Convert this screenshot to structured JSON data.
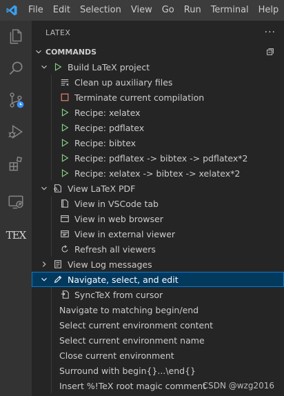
{
  "menubar": {
    "items": [
      "File",
      "Edit",
      "Selection",
      "View",
      "Go",
      "Run",
      "Terminal",
      "Help"
    ]
  },
  "activitybar": {
    "tex_label": "TEX"
  },
  "sidebar": {
    "title": "LATEX",
    "more_label": "···",
    "section": "COMMANDS",
    "groups": {
      "build": {
        "label": "Build LaTeX project",
        "children": [
          "Clean up auxiliary files",
          "Terminate current compilation",
          "Recipe: xelatex",
          "Recipe: pdflatex",
          "Recipe: bibtex",
          "Recipe: pdflatex -> bibtex -> pdflatex*2",
          "Recipe: xelatex -> bibtex -> xelatex*2"
        ]
      },
      "view": {
        "label": "View LaTeX PDF",
        "children": [
          "View in VSCode tab",
          "View in web browser",
          "View in external viewer",
          "Refresh all viewers"
        ]
      },
      "log": {
        "label": "View Log messages"
      },
      "navigate": {
        "label": "Navigate, select, and edit",
        "children": [
          "SyncTeX from cursor",
          "Navigate to matching begin/end",
          "Select current environment content",
          "Select current environment name",
          "Close current environment",
          "Surround with begin{}...\\end{}",
          "Insert %!TeX root magic comment"
        ]
      }
    }
  },
  "watermark": "CSDN @wzg2016",
  "colors": {
    "accent": "#007acc",
    "selection": "#04395e",
    "play_green": "#89d185",
    "stop_red": "#f48771"
  }
}
